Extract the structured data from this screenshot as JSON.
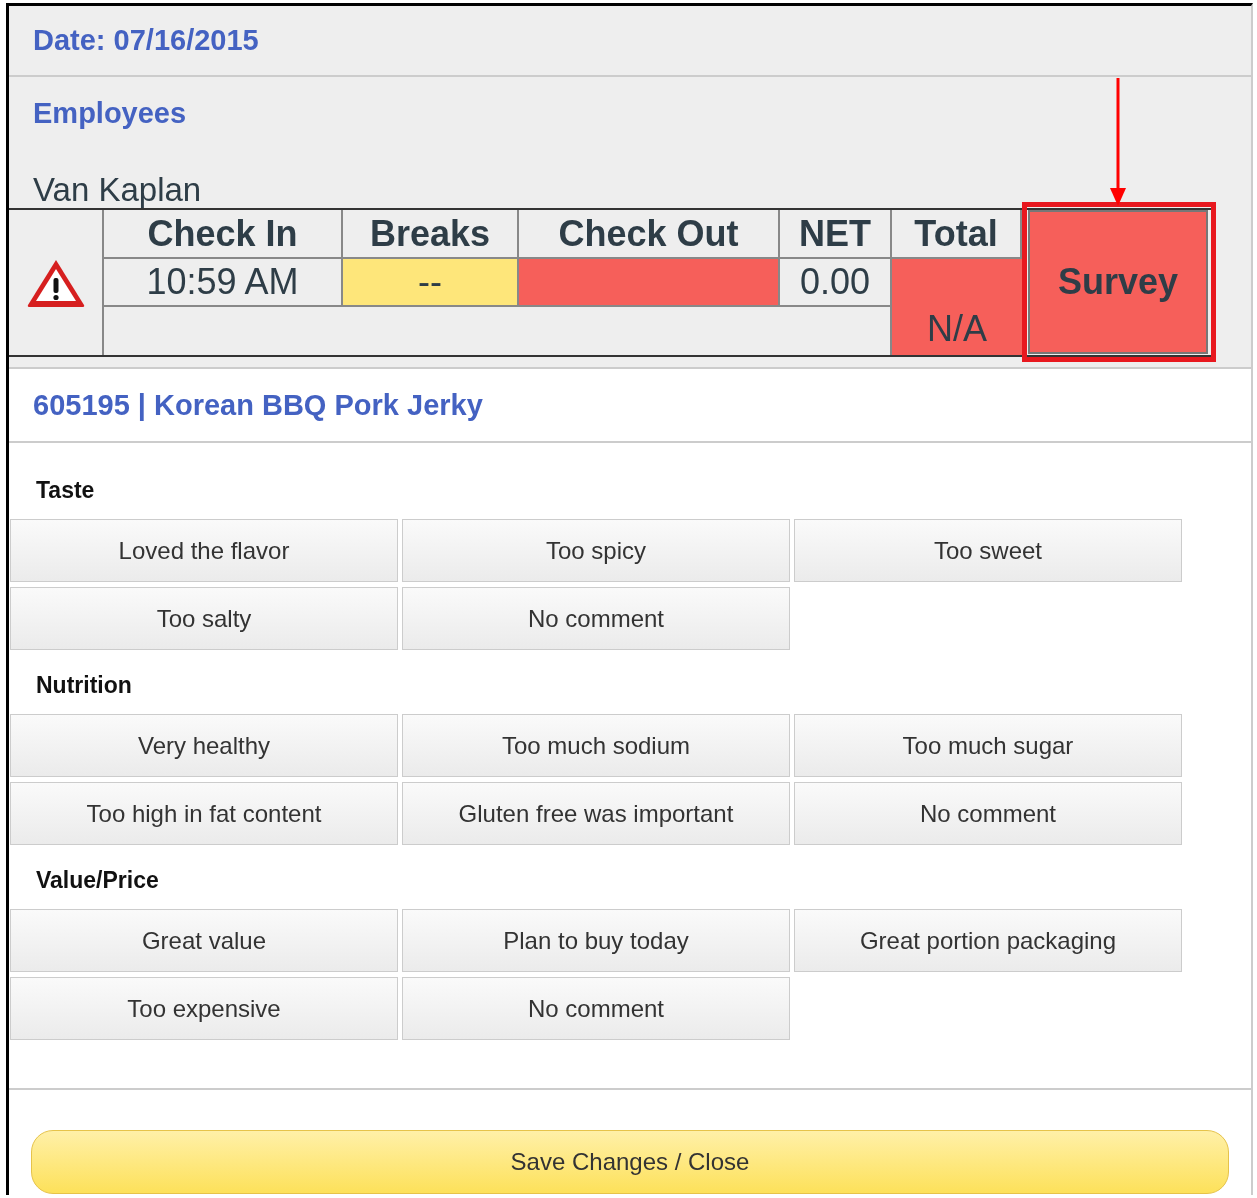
{
  "date": "Date: 07/16/2015",
  "section_title": "Employees",
  "employee": {
    "name": "Van Kaplan",
    "warning": true,
    "columns": [
      {
        "heading": "Check In",
        "value": "10:59 AM"
      },
      {
        "heading": "Breaks",
        "value": "--",
        "color": "#fee67a"
      },
      {
        "heading": "Check Out",
        "color": "#f65f5a"
      },
      {
        "heading": "NET",
        "value": "0.00"
      }
    ],
    "total": {
      "heading": "Total",
      "value": "N/A",
      "color": "#f65f5a"
    },
    "survey_button": {
      "label": "Survey",
      "color": "#f65f5a"
    }
  },
  "product": "605195 | Korean BBQ Pork Jerky",
  "categories": [
    {
      "title": "Taste",
      "options": [
        {
          "label": "Loved the flavor",
          "selected": false
        },
        {
          "label": "Too spicy",
          "selected": false
        },
        {
          "label": "Too sweet",
          "selected": false
        },
        {
          "label": "Too salty",
          "selected": false
        },
        {
          "label": "No comment",
          "selected": false
        }
      ]
    },
    {
      "title": "Nutrition",
      "options": [
        {
          "label": "Very healthy",
          "selected": false
        },
        {
          "label": "Too much sodium",
          "selected": false
        },
        {
          "label": "Too much sugar",
          "selected": false
        },
        {
          "label": "Too high in fat content",
          "selected": false
        },
        {
          "label": "Gluten free was important",
          "selected": false
        },
        {
          "label": "No comment",
          "selected": false
        }
      ]
    },
    {
      "title": "Value/Price",
      "options": [
        {
          "label": "Great value",
          "selected": false
        },
        {
          "label": "Plan to buy today",
          "selected": false
        },
        {
          "label": "Great portion packaging",
          "selected": false
        },
        {
          "label": "Too expensive",
          "selected": false
        },
        {
          "label": "No comment",
          "selected": false
        }
      ]
    }
  ],
  "save_button": "Save Changes / Close"
}
